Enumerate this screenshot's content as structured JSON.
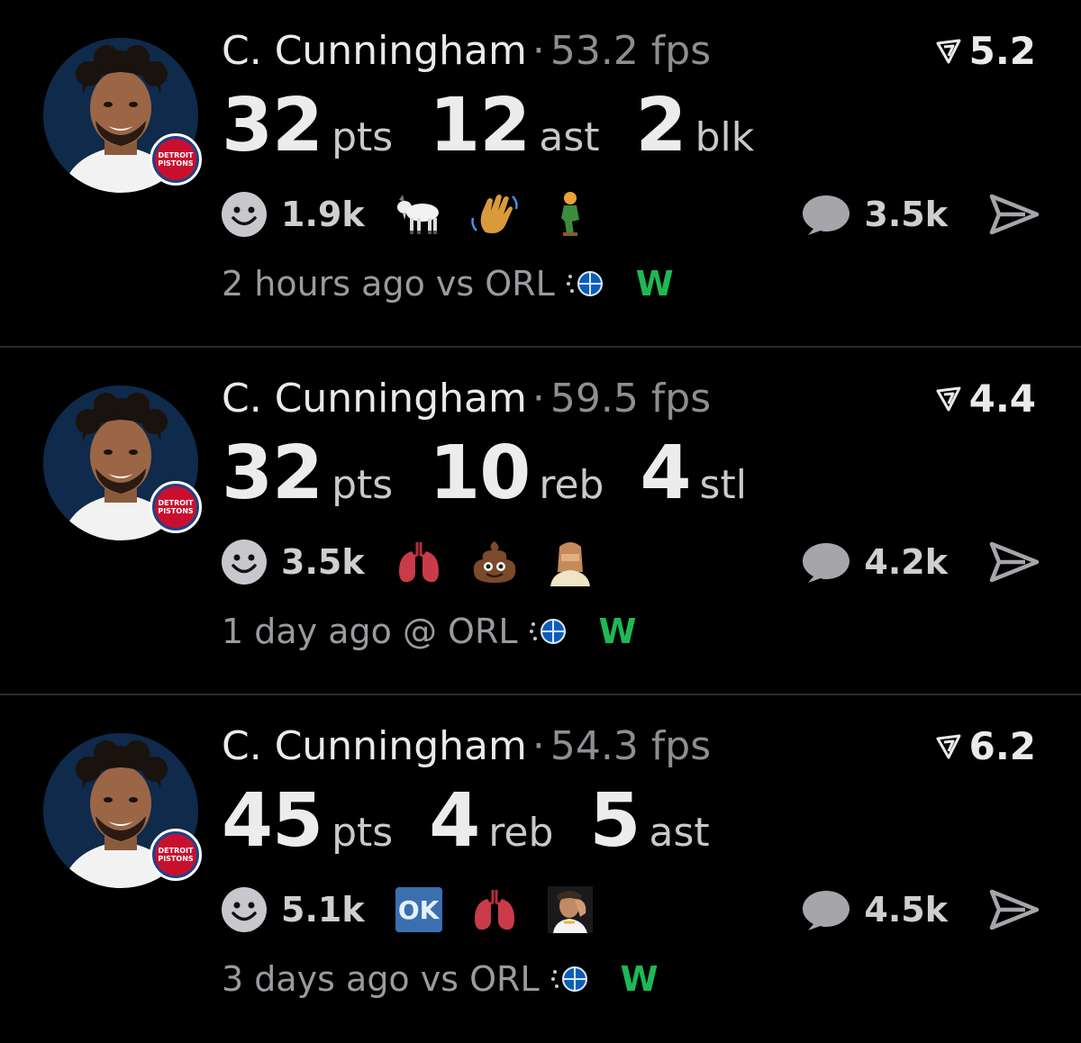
{
  "posts": [
    {
      "player_name": "C. Cunningham",
      "separator": "·",
      "fps": "53.2 fps",
      "rating": "5.2",
      "stats": [
        {
          "value": "32",
          "unit": "pts"
        },
        {
          "value": "12",
          "unit": "ast"
        },
        {
          "value": "2",
          "unit": "blk"
        }
      ],
      "reaction_count": "1.9k",
      "reaction_emojis": [
        "goat-icon",
        "waving-hand-icon",
        "kneeling-person-icon"
      ],
      "comment_count": "3.5k",
      "meta": "2 hours ago vs ORL",
      "result": "W",
      "team_badge": [
        "DETROIT",
        "PISTONS"
      ]
    },
    {
      "player_name": "C. Cunningham",
      "separator": "·",
      "fps": "59.5 fps",
      "rating": "4.4",
      "stats": [
        {
          "value": "32",
          "unit": "pts"
        },
        {
          "value": "10",
          "unit": "reb"
        },
        {
          "value": "4",
          "unit": "stl"
        }
      ],
      "reaction_count": "3.5k",
      "reaction_emojis": [
        "lungs-icon",
        "poop-icon",
        "person-in-mask-icon"
      ],
      "comment_count": "4.2k",
      "meta": "1 day ago @ ORL",
      "result": "W",
      "team_badge": [
        "DETROIT",
        "PISTONS"
      ]
    },
    {
      "player_name": "C. Cunningham",
      "separator": "·",
      "fps": "54.3 fps",
      "rating": "6.2",
      "stats": [
        {
          "value": "45",
          "unit": "pts"
        },
        {
          "value": "4",
          "unit": "reb"
        },
        {
          "value": "5",
          "unit": "ast"
        }
      ],
      "reaction_count": "5.1k",
      "reaction_emojis": [
        "ok-badge-icon",
        "lungs-icon",
        "player-face-palm-icon"
      ],
      "ok_label": "OK",
      "comment_count": "4.5k",
      "meta": "3 days ago vs ORL",
      "result": "W",
      "team_badge": [
        "DETROIT",
        "PISTONS"
      ]
    }
  ],
  "colors": {
    "background": "#000000",
    "win": "#1db954",
    "muted": "#8e8e93",
    "badge_red": "#c8102e",
    "badge_blue": "#1d428a"
  }
}
